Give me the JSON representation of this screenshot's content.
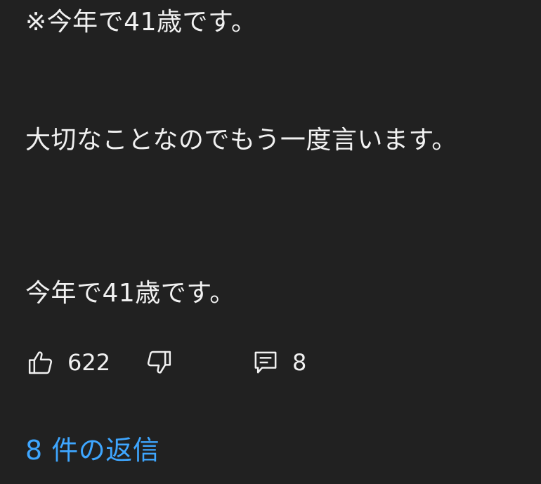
{
  "comment": {
    "lines": [
      "※今年で41歳です。",
      "大切なことなのでもう一度言います。",
      "今年で41歳です。"
    ]
  },
  "actions": {
    "like_count": "622",
    "reply_count": "8"
  },
  "replies": {
    "link_label": "8 件の返信"
  },
  "colors": {
    "background": "#212121",
    "text": "#f1f1f1",
    "link": "#3ea6ff"
  },
  "icons": {
    "like": "thumbs-up-icon",
    "dislike": "thumbs-down-icon",
    "reply": "comment-icon"
  }
}
